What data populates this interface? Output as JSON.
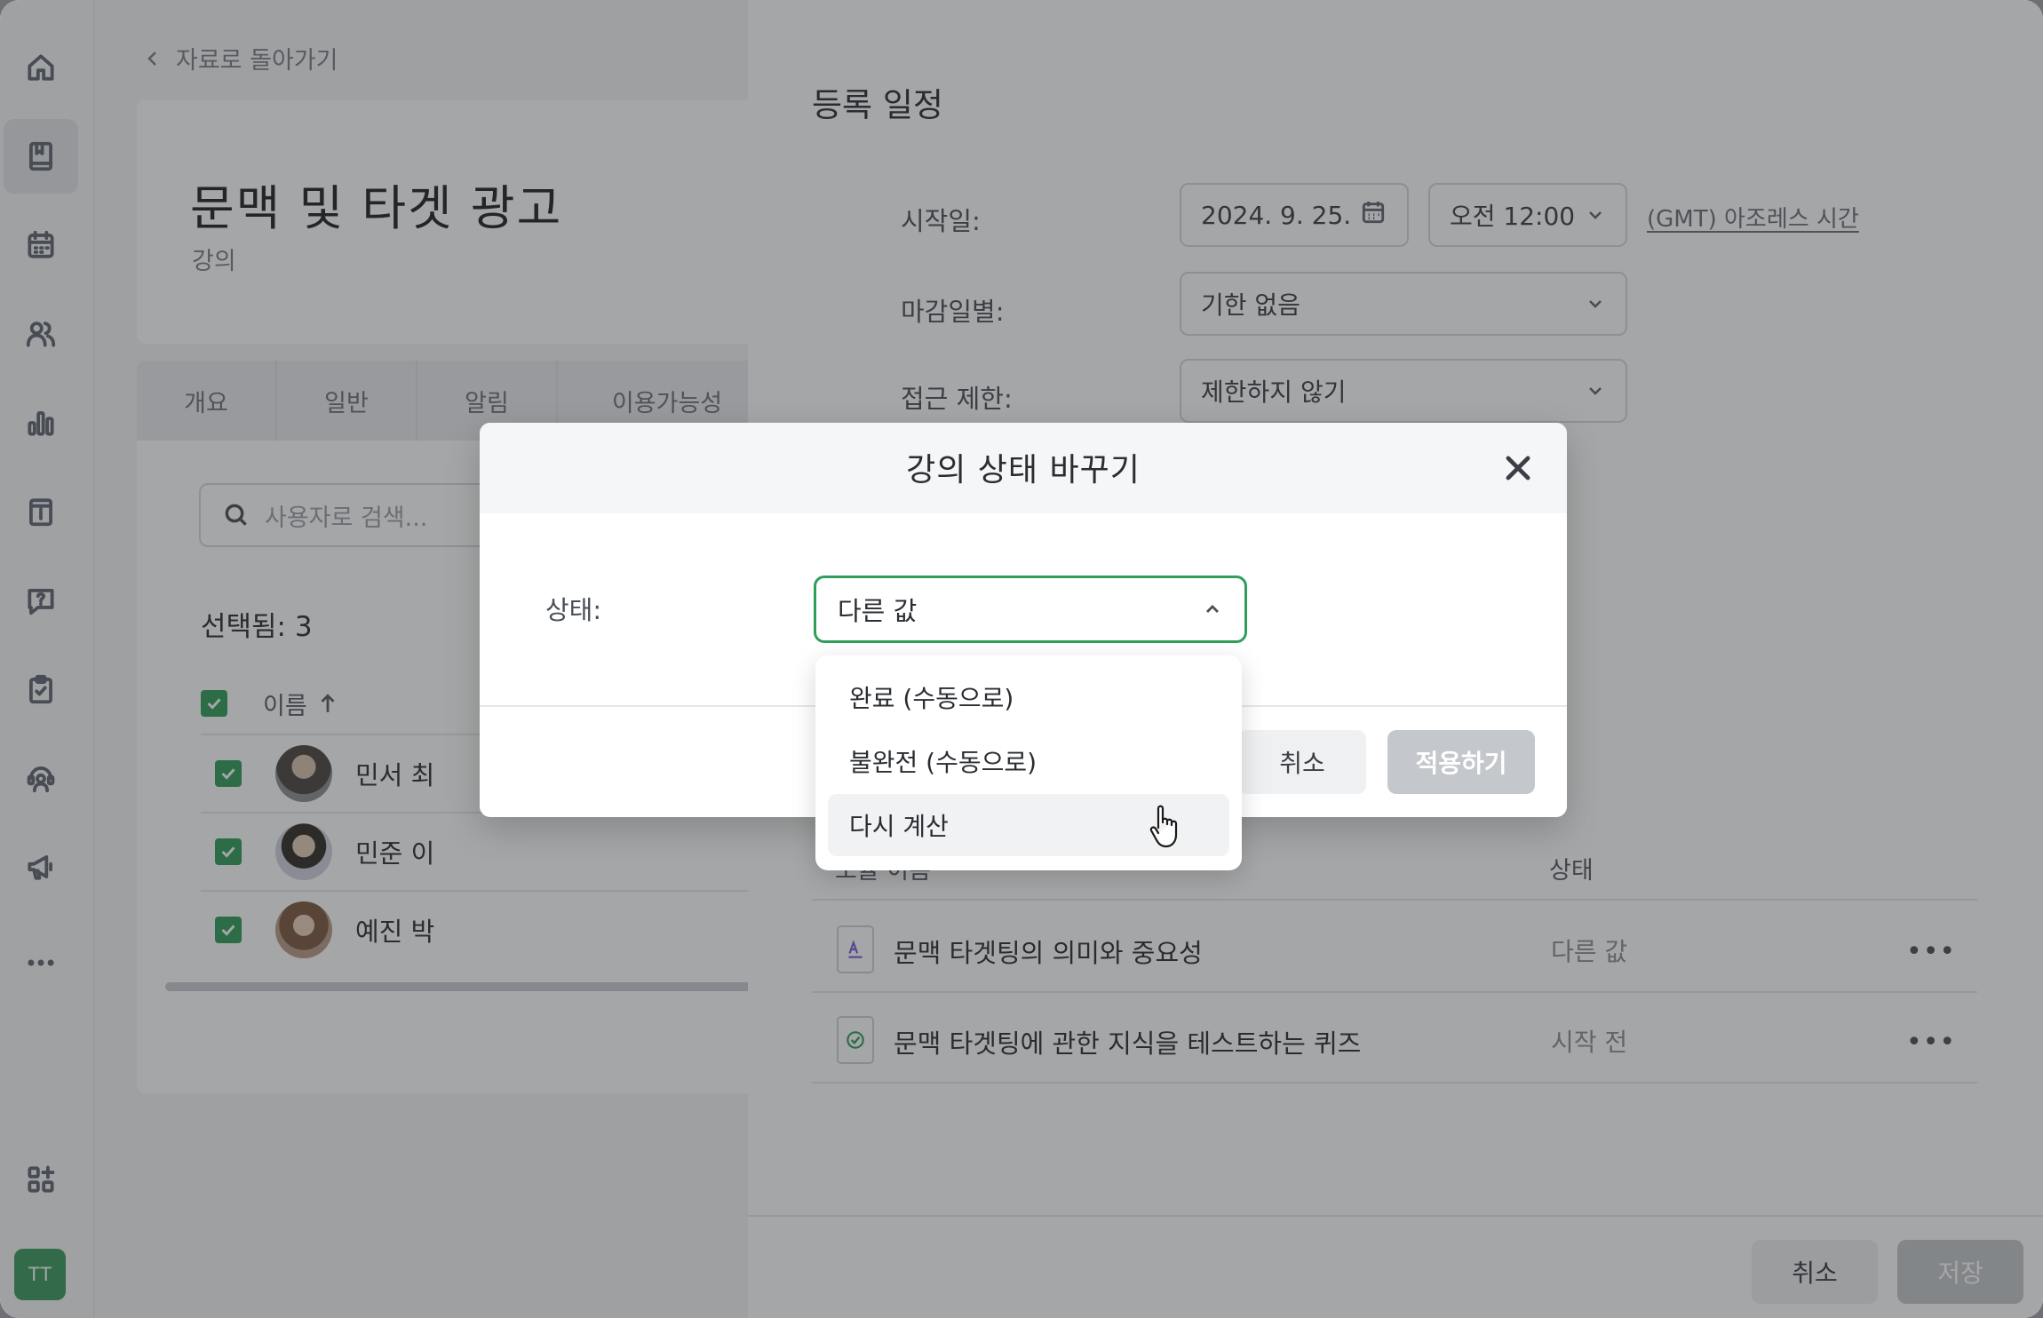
{
  "rail": {
    "items": [
      "home-icon",
      "book-icon",
      "calendar-icon",
      "users-icon",
      "chart-icon",
      "info-icon",
      "help-icon",
      "clipboard-icon",
      "support-icon",
      "megaphone-icon",
      "more-icon",
      "apps-icon"
    ],
    "avatar": "TT"
  },
  "left": {
    "back_label": "자료로 돌아가기",
    "course_title": "문맥 및 타겟 광고",
    "course_type": "강의",
    "tabs": [
      "개요",
      "일반",
      "알림",
      "이용가능성"
    ],
    "search_placeholder": "사용자로 검색...",
    "selected_count": "선택됨: 3",
    "name_header": "이름",
    "members": [
      {
        "name": "민서 최"
      },
      {
        "name": "민준 이"
      },
      {
        "name": "예진 박"
      }
    ]
  },
  "drawer": {
    "section_title": "등록 일정",
    "start_label": "시작일:",
    "start_date": "2024. 9. 25.",
    "start_time": "오전 12:00",
    "timezone": "(GMT) 아조레스 시간",
    "deadline_label": "마감일별:",
    "deadline_value": "기한 없음",
    "access_label": "접근 제한:",
    "access_value": "제한하지 않기",
    "table": {
      "col_name": "모듈 이름",
      "col_status": "상태",
      "rows": [
        {
          "title": "문맥 타겟팅의 의미와 중요성",
          "status": "다른 값",
          "icon": "document-icon"
        },
        {
          "title": "문맥 타겟팅에 관한 지식을 테스트하는 퀴즈",
          "status": "시작 전",
          "icon": "quiz-icon"
        }
      ]
    },
    "footer_cancel": "취소",
    "footer_save": "저장"
  },
  "modal": {
    "title": "강의 상태 바꾸기",
    "status_label": "상태:",
    "selected_value": "다른 값",
    "options": [
      "완료 (수동으로)",
      "불완전 (수동으로)",
      "다시 계산"
    ],
    "hovered_option": "다시 계산",
    "cancel_label": "취소",
    "apply_label": "적용하기"
  },
  "colors": {
    "accent": "#2f9e5b",
    "overlay": "#28292e"
  }
}
